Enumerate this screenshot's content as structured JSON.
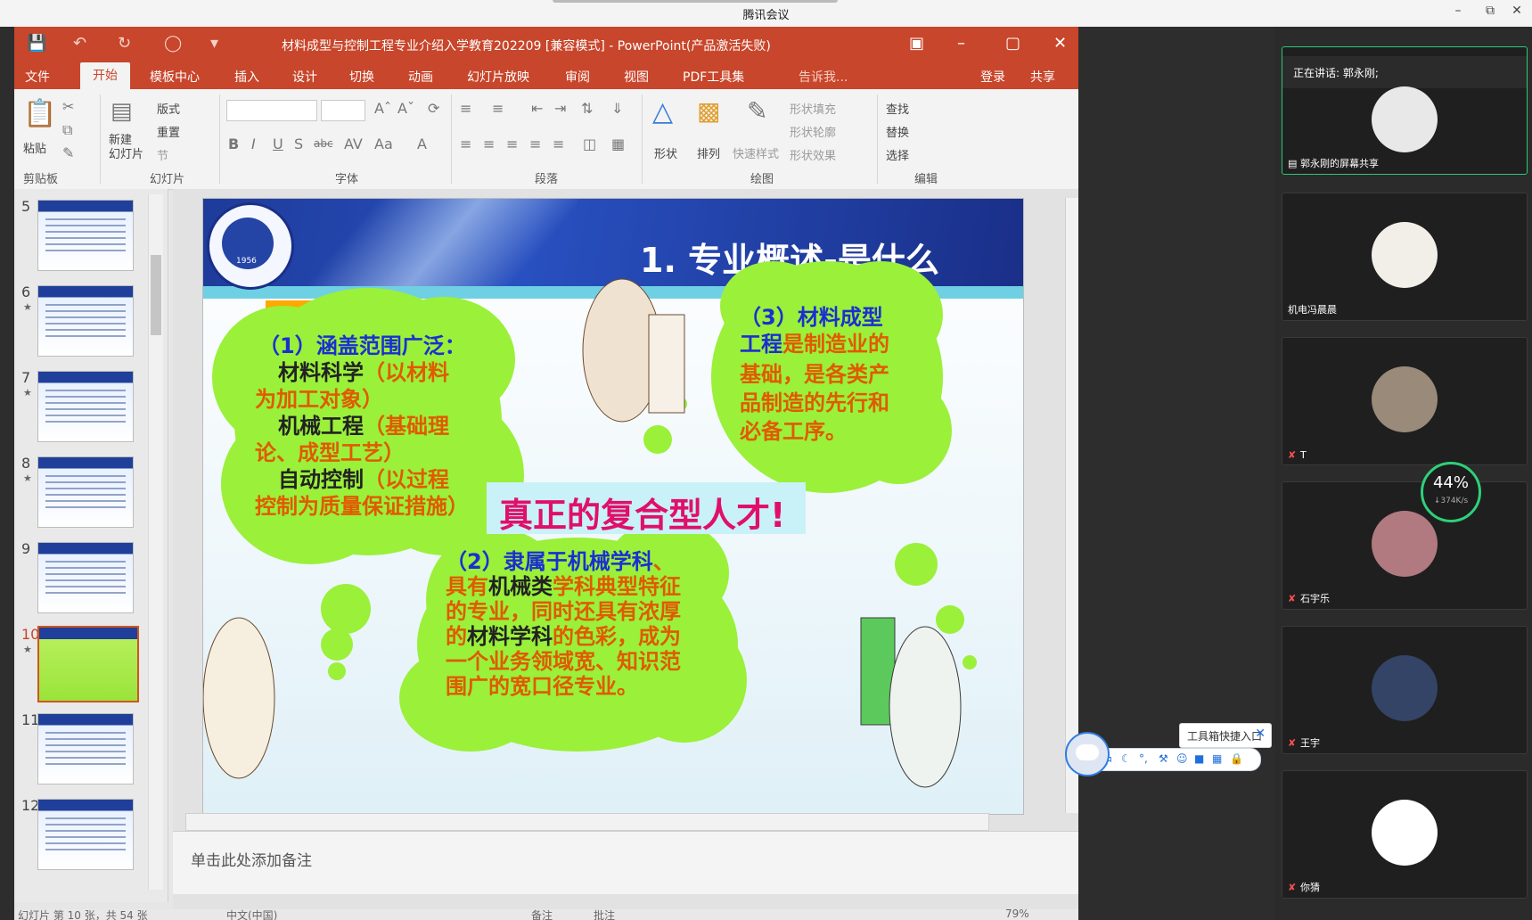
{
  "meeting": {
    "title": "腾讯会议"
  },
  "ppt": {
    "title": "材料成型与控制工程专业介绍入学教育202209 [兼容模式] - PowerPoint(产品激活失败)",
    "tabs": [
      "文件",
      "开始",
      "模板中心",
      "插入",
      "设计",
      "切换",
      "动画",
      "幻灯片放映",
      "审阅",
      "视图",
      "PDF工具集",
      "告诉我..."
    ],
    "active_tab": "开始",
    "login": "登录",
    "share": "共享",
    "ribbon": {
      "paste": "粘贴",
      "new_slide": "新建\n幻灯片",
      "layout": "版式",
      "reset": "重置",
      "section": "节",
      "shape": "形状",
      "arrange": "排列",
      "quick_style": "快速样式",
      "shape_fill": "形状填充",
      "shape_outline": "形状轮廓",
      "shape_effect": "形状效果",
      "find": "查找",
      "replace": "替换",
      "select": "选择",
      "groups": [
        "剪贴板",
        "幻灯片",
        "字体",
        "段落",
        "绘图",
        "编辑"
      ]
    },
    "thumbnails": [
      {
        "num": "5",
        "star": ""
      },
      {
        "num": "6",
        "star": "★"
      },
      {
        "num": "7",
        "star": "★"
      },
      {
        "num": "8",
        "star": "★"
      },
      {
        "num": "9",
        "star": ""
      },
      {
        "num": "10",
        "star": "★"
      },
      {
        "num": "11",
        "star": ""
      },
      {
        "num": "12",
        "star": ""
      }
    ],
    "selected_slide": "10",
    "notes_placeholder": "单击此处添加备注",
    "status": {
      "slide_info": "幻灯片 第 10 张，共 54 张",
      "lang": "中文(中国)",
      "notes": "备注",
      "comments": "批注",
      "zoom": "79%"
    }
  },
  "slide": {
    "title": "1. 专业概述-是什么",
    "logo_year": "1956",
    "cloud1": {
      "heading": "（1）涵盖范围广泛：",
      "l1a": "材料科学",
      "l1b": "（以材料",
      "l2": "为加工对象）",
      "l3a": "机械工程",
      "l3b": "（基础理",
      "l4": "论、成型工艺）",
      "l5a": "自动控制",
      "l5b": "（以过程",
      "l6": "控制为质量保证措施）"
    },
    "cloud2": {
      "h1": "（2）隶属于机械学科",
      "h2": "、",
      "l1a": "具有",
      "l1b": "机械类",
      "l1c": "学科典型特征",
      "l2": "的专业，同时还具有浓厚",
      "l3a": "的",
      "l3b": "材料学科",
      "l3c": "的色彩，成为",
      "l4": "一个业务领域宽、知识范",
      "l5": "围广的宽口径专业。"
    },
    "cloud3": {
      "h1": "（3）材料成型",
      "h2": "工程",
      "l1": "是制造业的",
      "l2": "基础，是各类产",
      "l3": "品制造的先行和",
      "l4": "必备工序。"
    },
    "banner": "真正的复合型人才!"
  },
  "floating": {
    "tooltip": "工具箱快捷入口"
  },
  "participants": {
    "speaking": "正在讲话: 郭永刚;",
    "cards": [
      {
        "name": "郭永刚的屏幕共享",
        "muted": false
      },
      {
        "name": "机电冯晨晨",
        "muted": false
      },
      {
        "name": "T",
        "muted": true
      },
      {
        "name": "石宇乐",
        "muted": true
      },
      {
        "name": "王宇",
        "muted": true
      },
      {
        "name": "你猜",
        "muted": true
      }
    ],
    "net": {
      "percent": "44%",
      "speed": "↓374K/s"
    }
  }
}
